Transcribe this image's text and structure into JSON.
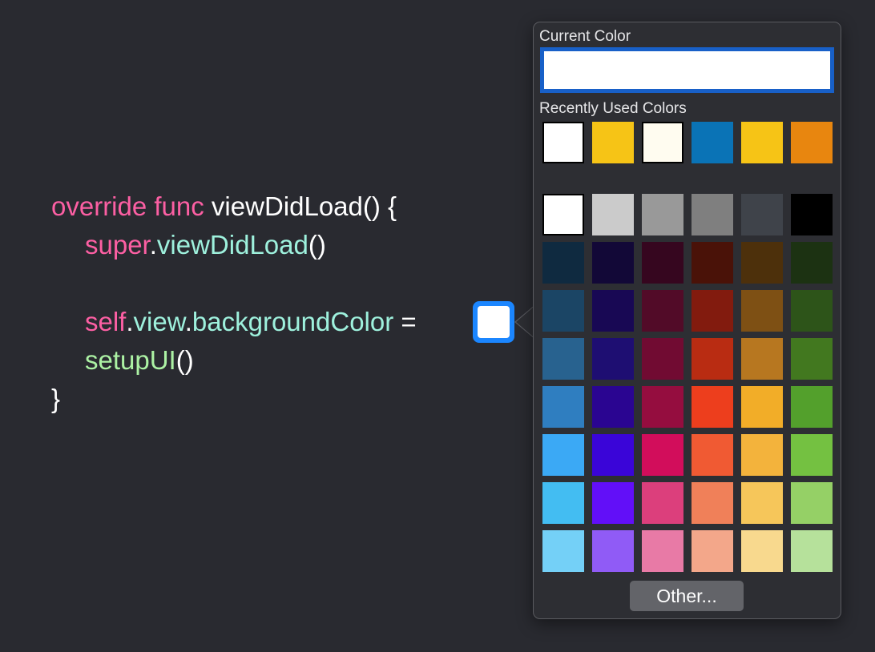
{
  "code": {
    "line1": {
      "kw": "override func",
      "rest": " viewDidLoad() {"
    },
    "line2": {
      "kw": "super",
      "dot": ".",
      "call": "viewDidLoad",
      "parens": "()"
    },
    "line3": {
      "kw": "self",
      "dot1": ".",
      "mem1": "view",
      "dot2": ".",
      "mem2": "backgroundColor",
      "eq": " ="
    },
    "line4": {
      "call": "setupUI",
      "parens": "()"
    },
    "line5": {
      "brace": "}"
    }
  },
  "color_literal": {
    "color": "#ffffff",
    "accent": "#1b86ff"
  },
  "color_picker": {
    "current_label": "Current Color",
    "current_color": "#ffffff",
    "recent_label": "Recently Used Colors",
    "recent_colors": [
      "#ffffff",
      "#f6c416",
      "#fffcf0",
      "#0a73b6",
      "#f6c416",
      "#e8860f"
    ],
    "palette": [
      [
        "#ffffff",
        "#cbcbcb",
        "#999999",
        "#7f7f7f",
        "#3f434a",
        "#000000"
      ],
      [
        "#0f2a40",
        "#120837",
        "#36061f",
        "#4a1208",
        "#4d300b",
        "#1c3212"
      ],
      [
        "#1b4565",
        "#180854",
        "#520b28",
        "#821b0e",
        "#7e5014",
        "#2d5419"
      ],
      [
        "#28628f",
        "#1e0e72",
        "#710b32",
        "#b92c12",
        "#b77720",
        "#42781f"
      ],
      [
        "#2f7ec0",
        "#2a0591",
        "#950d3f",
        "#ed3e1d",
        "#f2ad28",
        "#53a02c"
      ],
      [
        "#3ba9f5",
        "#3a05d8",
        "#d20d5b",
        "#f05a33",
        "#f3b33c",
        "#74c141"
      ],
      [
        "#43bdf2",
        "#620ff8",
        "#dc3f7c",
        "#f08059",
        "#f6c65a",
        "#95d066"
      ],
      [
        "#74d0f7",
        "#905bf6",
        "#e87aa6",
        "#f3a78a",
        "#f8d98e",
        "#b6e19b"
      ]
    ],
    "other_button": "Other..."
  }
}
